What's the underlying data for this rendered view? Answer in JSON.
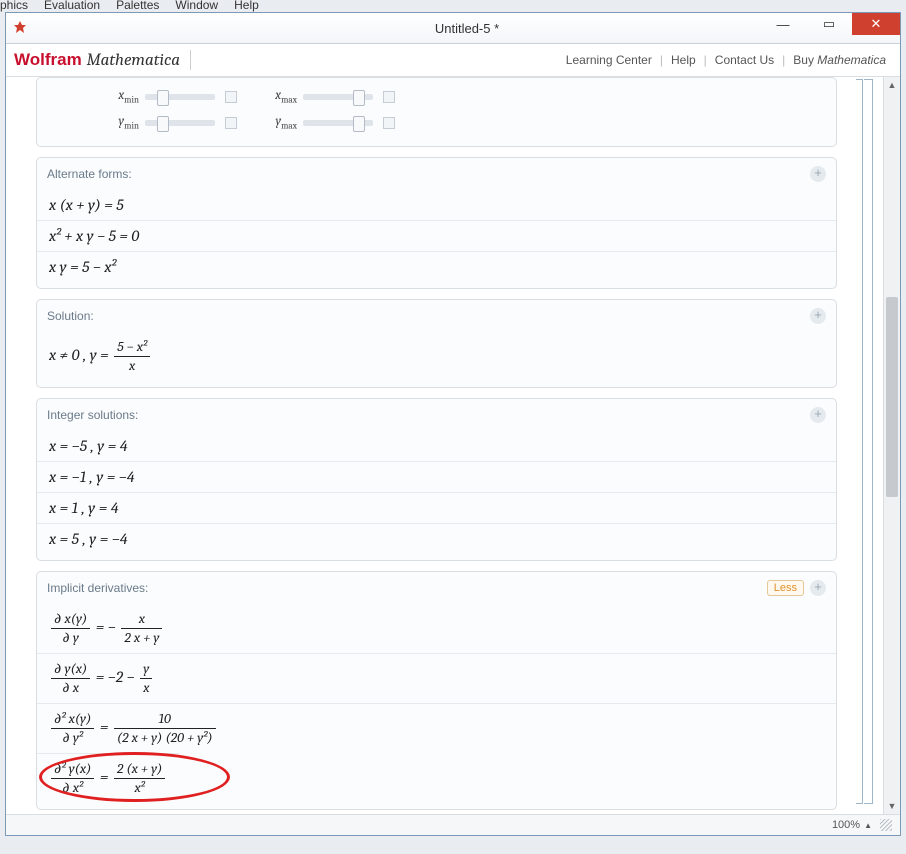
{
  "menubar_fragments": [
    "phics",
    "Evaluation",
    "Palettes",
    "Window",
    "Help"
  ],
  "window": {
    "title": "Untitled-5 *"
  },
  "header": {
    "brand_a": "Wolfram",
    "brand_b": "Mathematica",
    "links": {
      "learning": "Learning Center",
      "help": "Help",
      "contact": "Contact Us",
      "buy_prefix": "Buy ",
      "buy_math": "Mathematica"
    }
  },
  "top_sliders": {
    "xmin": "x",
    "xmin_sub": "min",
    "xmax": "x",
    "xmax_sub": "max",
    "ymin": "y",
    "ymin_sub": "min",
    "ymax": "y",
    "ymax_sub": "max"
  },
  "pods": {
    "alternate": {
      "title": "Alternate forms:",
      "rows": [
        "x (x + y) = 5",
        "x² + x y − 5 = 0",
        "x y = 5 − x²"
      ]
    },
    "solution": {
      "title": "Solution:",
      "prefix": "x ≠ 0 ,    y = ",
      "frac_num": "5 − x²",
      "frac_den": "x"
    },
    "integer": {
      "title": "Integer solutions:",
      "rows": [
        "x = −5 ,    y = 4",
        "x = −1 ,    y = −4",
        "x = 1 ,    y = 4",
        "x = 5 ,    y = −4"
      ]
    },
    "implicit": {
      "title": "Implicit derivatives:",
      "less": "Less",
      "d1": {
        "lnum": "∂ x(y)",
        "lden": "∂ y",
        "eq": " = − ",
        "rnum": "x",
        "rden": "2 x + y"
      },
      "d2": {
        "lnum": "∂ y(x)",
        "lden": "∂ x",
        "eq": " = −2 − ",
        "rnum": "y",
        "rden": "x"
      },
      "d3": {
        "lnum": "∂² x(y)",
        "lden": "∂ y²",
        "eq": " = ",
        "rnum": "10",
        "rden": "(2 x + y) (20 + y²)"
      },
      "d4": {
        "lnum": "∂² y(x)",
        "lden": "∂ x²",
        "eq": " = ",
        "rnum": "2 (x + y)",
        "rden": "x²"
      }
    }
  },
  "status": {
    "zoom": "100%"
  }
}
